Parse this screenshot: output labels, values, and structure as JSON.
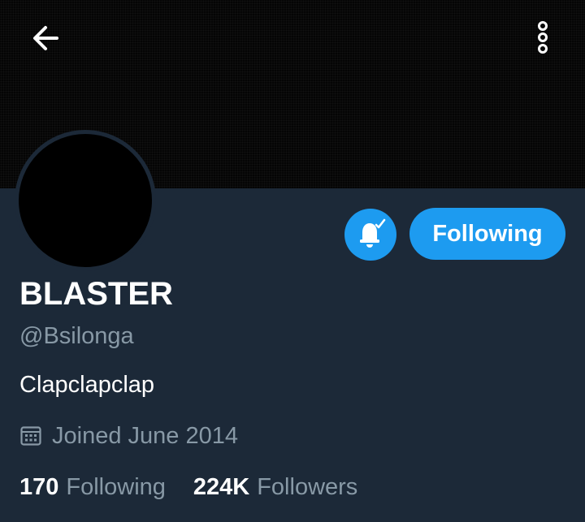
{
  "header": {
    "back_icon": "arrow-left-icon",
    "more_icon": "more-vertical-icon"
  },
  "profile": {
    "display_name": "BLASTER",
    "handle": "@Bsilonga",
    "bio": "Clapclapclap",
    "joined": "Joined June 2014",
    "joined_icon": "calendar-icon"
  },
  "actions": {
    "notify_icon": "bell-check-icon",
    "follow_label": "Following"
  },
  "stats": {
    "following_count": "170",
    "following_label": "Following",
    "followers_count": "224K",
    "followers_label": "Followers"
  },
  "colors": {
    "background": "#1c2938",
    "accent": "#1d9bf0",
    "secondary_text": "#8899a6",
    "banner": "#050505"
  }
}
